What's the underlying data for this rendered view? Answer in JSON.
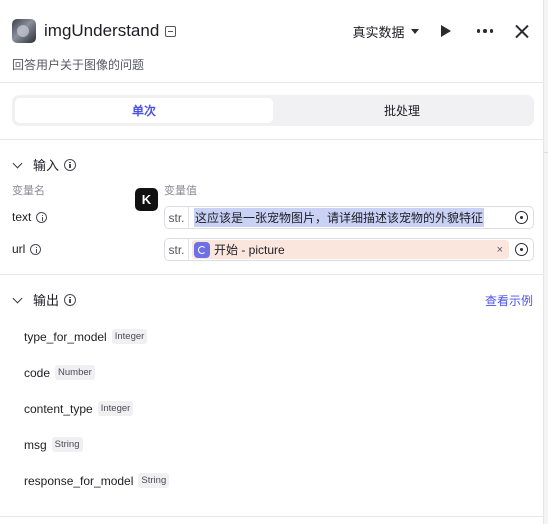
{
  "header": {
    "title": "imgUnderstand",
    "description": "回答用户关于图像的问题",
    "mode_label": "真实数据"
  },
  "tabs": [
    {
      "label": "单次",
      "active": true
    },
    {
      "label": "批处理",
      "active": false
    }
  ],
  "input_section": {
    "title": "输入",
    "col_name": "变量名",
    "col_value": "变量值",
    "rows": [
      {
        "name": "text",
        "type": "str.",
        "value": "这应该是一张宠物图片，请详细描述该宠物的外貌特征"
      },
      {
        "name": "url",
        "type": "str.",
        "ref_value": "开始 - picture",
        "ref_remove": "×"
      }
    ]
  },
  "output_section": {
    "title": "输出",
    "view_example": "查看示例",
    "fields": [
      {
        "name": "type_for_model",
        "type": "Integer"
      },
      {
        "name": "code",
        "type": "Number"
      },
      {
        "name": "content_type",
        "type": "Integer"
      },
      {
        "name": "msg",
        "type": "String"
      },
      {
        "name": "response_for_model",
        "type": "String"
      }
    ]
  },
  "colors": {
    "accent": "#4d53e8",
    "highlight": "#c9d1f5",
    "ref_chip": "#fbe6dd"
  },
  "icons": [
    "app-icon",
    "edit-icon",
    "caret-down-icon",
    "play-icon",
    "more-icon",
    "close-icon",
    "chevron-down-icon",
    "info-icon",
    "k-logo-icon",
    "target-icon",
    "start-node-icon"
  ]
}
